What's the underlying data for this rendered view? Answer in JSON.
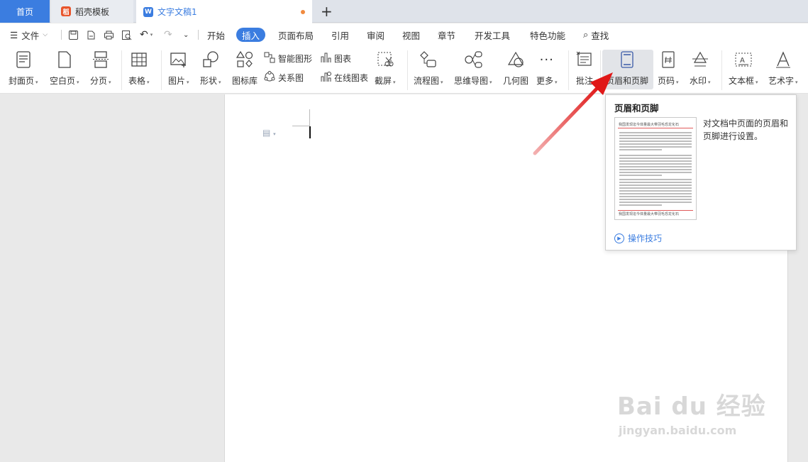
{
  "tabs": {
    "home": "首页",
    "daoke": "稻壳模板",
    "doc": "文字文稿1",
    "plus": "+"
  },
  "menu": {
    "file": "文件",
    "items": [
      "开始",
      "插入",
      "页面布局",
      "引用",
      "审阅",
      "视图",
      "章节",
      "开发工具",
      "特色功能"
    ],
    "active_index": 1,
    "search": "查找"
  },
  "ribbon": {
    "cover": "封面页",
    "blank": "空白页",
    "pagebreak": "分页",
    "table": "表格",
    "picture": "图片",
    "shape": "形状",
    "iconlib": "图标库",
    "smartart": "智能图形",
    "chart": "图表",
    "relation": "关系图",
    "onlinechart": "在线图表",
    "screenshot": "截屏",
    "flowchart": "流程图",
    "mindmap": "思维导图",
    "geometry": "几何图",
    "more": "更多",
    "comment": "批注",
    "headerfooter": "页眉和页脚",
    "pagenum": "页码",
    "watermark": "水印",
    "textbox": "文本框",
    "wordart": "艺术字"
  },
  "popup": {
    "title": "页眉和页脚",
    "description": "对文档中页面的页眉和页脚进行设置。",
    "thumb_header": "我国发现迄今体量最大带羽毛恐龙化石",
    "thumb_footer": "我国发现迄今体量最大带羽毛恐龙化石",
    "link": "操作技巧"
  },
  "watermark": {
    "brand": "Bai du 经验",
    "url": "jingyan.baidu.com"
  },
  "colors": {
    "accent": "#3b7de0",
    "arrow": "#e02020"
  }
}
